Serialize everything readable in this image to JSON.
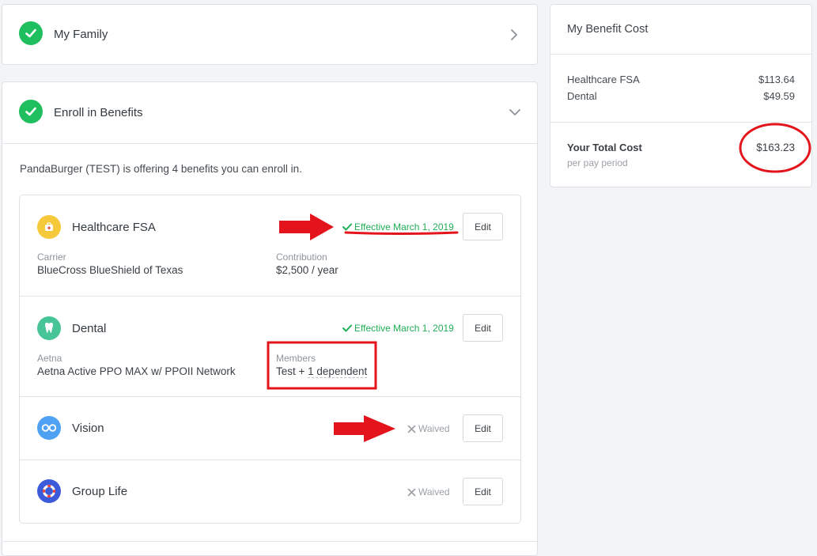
{
  "family": {
    "title": "My Family"
  },
  "enroll": {
    "title": "Enroll in Benefits",
    "offer_text": "PandaBurger (TEST) is offering 4 benefits you can enroll in.",
    "benefits": [
      {
        "name": "Healthcare FSA",
        "status": "Effective March 1, 2019",
        "edit": "Edit",
        "field1_label": "Carrier",
        "field1_value": "BlueCross BlueShield of Texas",
        "field2_label": "Contribution",
        "field2_value": "$2,500 / year"
      },
      {
        "name": "Dental",
        "status": "Effective March 1, 2019",
        "edit": "Edit",
        "field1_label": "Aetna",
        "field1_value": "Aetna Active PPO MAX w/ PPOII Network",
        "field2_label": "Members",
        "field2_value_prefix": "Test + ",
        "field2_value_link": "1 dependent"
      },
      {
        "name": "Vision",
        "status": "Waived",
        "edit": "Edit"
      },
      {
        "name": "Group Life",
        "status": "Waived",
        "edit": "Edit"
      }
    ]
  },
  "cost": {
    "title": "My Benefit Cost",
    "lines": [
      {
        "label": "Healthcare FSA",
        "value": "$113.64"
      },
      {
        "label": "Dental",
        "value": "$49.59"
      }
    ],
    "total_label": "Your Total Cost",
    "total_sub": "per pay period",
    "total_value": "$163.23"
  },
  "icons": {
    "check": "check-icon",
    "chevron_right": "chevron-right-icon",
    "chevron_down": "chevron-down-icon",
    "fsa": "medical-bag-icon",
    "dental": "tooth-icon",
    "vision": "glasses-icon",
    "life": "life-ring-icon",
    "waived": "x-icon"
  },
  "colors": {
    "success": "#1fbf5f",
    "annotation": "#e3141b",
    "fsa": "#f6c93a",
    "dental": "#48c597",
    "vision": "#4ea1f3",
    "life": "#3b5bdb"
  }
}
